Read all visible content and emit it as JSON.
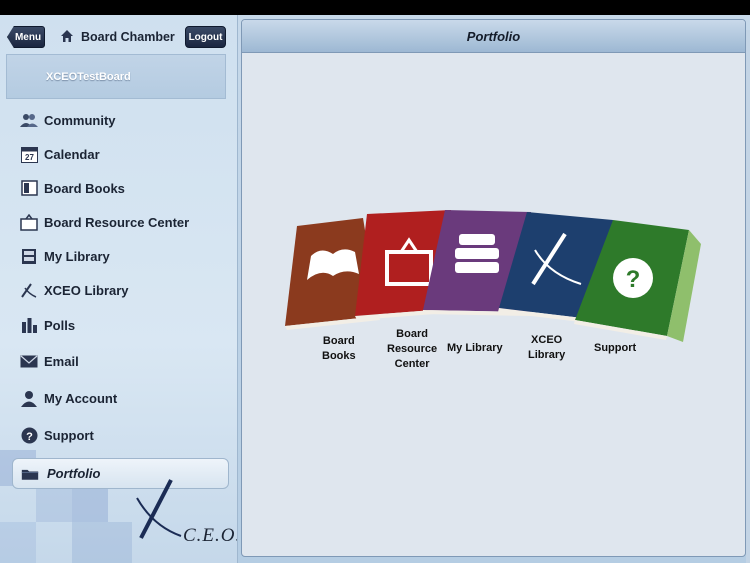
{
  "sidebar": {
    "menu_label": "Menu",
    "logout_label": "Logout",
    "title": "Board Chamber",
    "board_name": "XCEOTestBoard",
    "items": [
      {
        "label": "Community",
        "icon": "community-icon"
      },
      {
        "label": "Calendar",
        "icon": "calendar-icon",
        "icon_text": "27"
      },
      {
        "label": "Board Books",
        "icon": "book-icon"
      },
      {
        "label": "Board Resource Center",
        "icon": "easel-icon"
      },
      {
        "label": "My Library",
        "icon": "library-icon"
      },
      {
        "label": "XCEO Library",
        "icon": "xceo-icon"
      },
      {
        "label": "Polls",
        "icon": "polls-icon"
      },
      {
        "label": "Email",
        "icon": "envelope-icon"
      },
      {
        "label": "My Account",
        "icon": "person-icon"
      },
      {
        "label": "Support",
        "icon": "help-icon"
      },
      {
        "label": "Portfolio",
        "icon": "folder-icon",
        "active": true
      }
    ],
    "logo_text": "C.E.O."
  },
  "main": {
    "title": "Portfolio",
    "books": [
      {
        "label": "Board\nBooks",
        "color": "#8b3a1e"
      },
      {
        "label": "Board\nResource\nCenter",
        "color": "#b01f1f"
      },
      {
        "label": "My Library",
        "color": "#6a3a7c"
      },
      {
        "label": "XCEO\nLibrary",
        "color": "#1d3f6e"
      },
      {
        "label": "Support",
        "color": "#2e7a2a"
      }
    ]
  },
  "colors": {
    "accent_dark": "#1a2640",
    "sidebar_bg": "#d9e7f3",
    "text": "#1b2434"
  }
}
